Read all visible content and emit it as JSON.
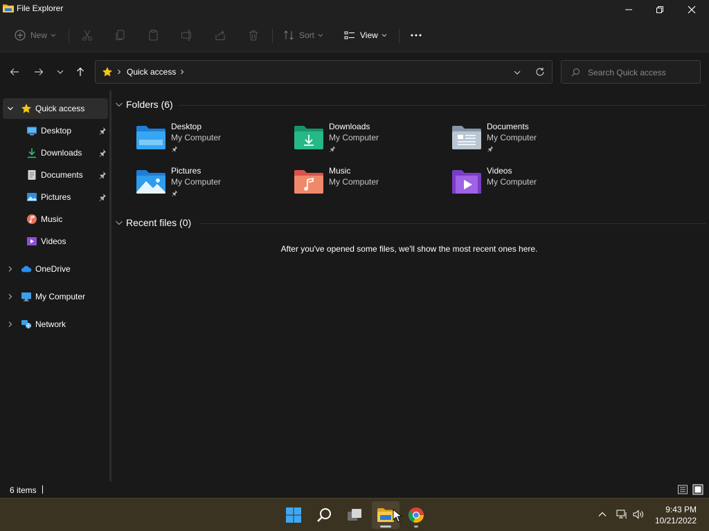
{
  "window": {
    "title": "File Explorer",
    "icon": "folder-icon",
    "controls": [
      "minimize-icon",
      "restore-icon",
      "close-icon"
    ]
  },
  "toolbar": {
    "new_label": "New",
    "sort_label": "Sort",
    "view_label": "View",
    "icons": [
      "new-icon",
      "cut-icon",
      "copy-icon",
      "paste-icon",
      "rename-icon",
      "share-icon",
      "delete-icon",
      "sort-icon",
      "view-icon",
      "more-icon"
    ]
  },
  "address": {
    "location": "Quick access",
    "location_icon": "star-icon"
  },
  "search": {
    "placeholder": "Search Quick access"
  },
  "sidebar": {
    "items": [
      {
        "label": "Quick access",
        "icon": "star-icon",
        "selected": true,
        "expanded": true
      },
      {
        "label": "Desktop",
        "icon": "desktop-icon",
        "pinned": true
      },
      {
        "label": "Downloads",
        "icon": "download-icon",
        "pinned": true
      },
      {
        "label": "Documents",
        "icon": "document-icon",
        "pinned": true
      },
      {
        "label": "Pictures",
        "icon": "picture-icon",
        "pinned": true
      },
      {
        "label": "Music",
        "icon": "music-icon",
        "pinned": false
      },
      {
        "label": "Videos",
        "icon": "video-icon",
        "pinned": false
      },
      {
        "label": "OneDrive",
        "icon": "cloud-icon",
        "expanded": false
      },
      {
        "label": "My Computer",
        "icon": "computer-icon",
        "expanded": false
      },
      {
        "label": "Network",
        "icon": "network-icon",
        "expanded": false
      }
    ]
  },
  "main": {
    "folders_header": "Folders (6)",
    "recent_header": "Recent files (0)",
    "empty_message": "After you've opened some files, we'll show the most recent ones here.",
    "folders": [
      {
        "name": "Desktop",
        "location": "My Computer",
        "pinned": true,
        "icon": "desktop-folder-icon"
      },
      {
        "name": "Downloads",
        "location": "My Computer",
        "pinned": true,
        "icon": "downloads-folder-icon"
      },
      {
        "name": "Documents",
        "location": "My Computer",
        "pinned": true,
        "icon": "documents-folder-icon"
      },
      {
        "name": "Pictures",
        "location": "My Computer",
        "pinned": true,
        "icon": "pictures-folder-icon"
      },
      {
        "name": "Music",
        "location": "My Computer",
        "pinned": false,
        "icon": "music-folder-icon"
      },
      {
        "name": "Videos",
        "location": "My Computer",
        "pinned": false,
        "icon": "videos-folder-icon"
      }
    ]
  },
  "status": {
    "items_count": "6 items"
  },
  "taskbar": {
    "apps": [
      "start-icon",
      "search-icon",
      "task-view-icon",
      "file-explorer-icon",
      "chrome-icon"
    ],
    "time": "9:43 PM",
    "date": "10/21/2022"
  },
  "colors": {
    "background": "#191919",
    "chrome": "#202020",
    "taskbar": "#3b3321",
    "accent_star": "#f5c518"
  }
}
